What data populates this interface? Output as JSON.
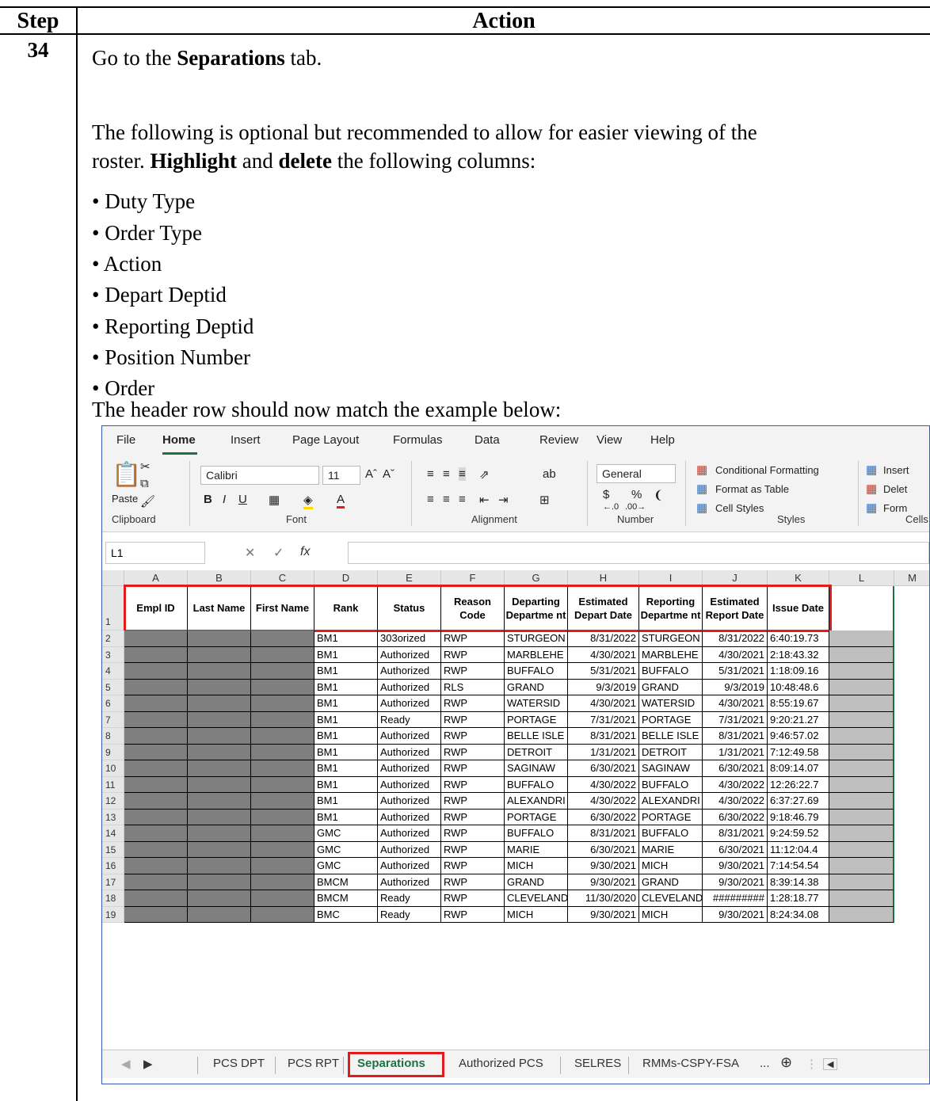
{
  "doc": {
    "header": {
      "step": "Step",
      "action": "Action"
    },
    "step_number": "34",
    "line1_pre": "Go to the ",
    "line1_bold": "Separations",
    "line1_post": " tab.",
    "para_line1": "The following is optional but recommended to allow for easier viewing of the",
    "para_line2_pre": "roster.  ",
    "para_line2_bold1": "Highlight",
    "para_line2_mid": " and ",
    "para_line2_bold2": "delete",
    "para_line2_post": " the following columns:",
    "bullets": [
      "Duty Type",
      "Order Type",
      "Action",
      "Depart Deptid",
      "Reporting Deptid",
      "Position Number",
      "Order"
    ],
    "closing": "The header row should now match the example below:"
  },
  "excel": {
    "menu": [
      "File",
      "Home",
      "Insert",
      "Page Layout",
      "Formulas",
      "Data",
      "Review",
      "View",
      "Help"
    ],
    "ribbon": {
      "paste": "Paste",
      "font_name": "Calibri",
      "font_size": "11",
      "number_format": "General",
      "conditional_formatting": "Conditional Formatting",
      "format_as_table": "Format as Table",
      "cell_styles": "Cell Styles",
      "insert": "Insert",
      "delete": "Delet",
      "format": "Form",
      "groups": [
        "Clipboard",
        "Font",
        "Alignment",
        "Number",
        "Styles",
        "Cells"
      ]
    },
    "name_box": "L1",
    "fx": "fx",
    "columns": [
      "A",
      "B",
      "C",
      "D",
      "E",
      "F",
      "G",
      "H",
      "I",
      "J",
      "K",
      "L",
      "M"
    ],
    "headers": [
      "Empl ID",
      "Last Name",
      "First Name",
      "Rank",
      "Status",
      "Reason Code",
      "Departing Departme nt",
      "Estimated Depart Date",
      "Reporting Departme nt",
      "Estimated Report Date",
      "Issue Date"
    ],
    "rows": [
      {
        "n": "2",
        "rank": "BM1",
        "status": "303orized",
        "reason": "RWP",
        "dep": "STURGEON",
        "depdate": "8/31/2022",
        "rep": "STURGEON",
        "repdate": "8/31/2022",
        "issue": "6:40:19.73"
      },
      {
        "n": "3",
        "rank": "BM1",
        "status": "Authorized",
        "reason": "RWP",
        "dep": "MARBLEHE",
        "depdate": "4/30/2021",
        "rep": "MARBLEHE",
        "repdate": "4/30/2021",
        "issue": "2:18:43.32"
      },
      {
        "n": "4",
        "rank": "BM1",
        "status": "Authorized",
        "reason": "RWP",
        "dep": "BUFFALO",
        "depdate": "5/31/2021",
        "rep": "BUFFALO",
        "repdate": "5/31/2021",
        "issue": "1:18:09.16"
      },
      {
        "n": "5",
        "rank": "BM1",
        "status": "Authorized",
        "reason": "RLS",
        "dep": "GRAND",
        "depdate": "9/3/2019",
        "rep": "GRAND",
        "repdate": "9/3/2019",
        "issue": "10:48:48.6"
      },
      {
        "n": "6",
        "rank": "BM1",
        "status": "Authorized",
        "reason": "RWP",
        "dep": "WATERSID",
        "depdate": "4/30/2021",
        "rep": "WATERSID",
        "repdate": "4/30/2021",
        "issue": "8:55:19.67"
      },
      {
        "n": "7",
        "rank": "BM1",
        "status": "Ready",
        "reason": "RWP",
        "dep": "PORTAGE",
        "depdate": "7/31/2021",
        "rep": "PORTAGE",
        "repdate": "7/31/2021",
        "issue": "9:20:21.27"
      },
      {
        "n": "8",
        "rank": "BM1",
        "status": "Authorized",
        "reason": "RWP",
        "dep": "BELLE ISLE",
        "depdate": "8/31/2021",
        "rep": "BELLE ISLE",
        "repdate": "8/31/2021",
        "issue": "9:46:57.02"
      },
      {
        "n": "9",
        "rank": "BM1",
        "status": "Authorized",
        "reason": "RWP",
        "dep": "DETROIT",
        "depdate": "1/31/2021",
        "rep": "DETROIT",
        "repdate": "1/31/2021",
        "issue": "7:12:49.58"
      },
      {
        "n": "10",
        "rank": "BM1",
        "status": "Authorized",
        "reason": "RWP",
        "dep": "SAGINAW",
        "depdate": "6/30/2021",
        "rep": "SAGINAW",
        "repdate": "6/30/2021",
        "issue": "8:09:14.07"
      },
      {
        "n": "11",
        "rank": "BM1",
        "status": "Authorized",
        "reason": "RWP",
        "dep": "BUFFALO",
        "depdate": "4/30/2022",
        "rep": "BUFFALO",
        "repdate": "4/30/2022",
        "issue": "12:26:22.7"
      },
      {
        "n": "12",
        "rank": "BM1",
        "status": "Authorized",
        "reason": "RWP",
        "dep": "ALEXANDRI",
        "depdate": "4/30/2022",
        "rep": "ALEXANDRI",
        "repdate": "4/30/2022",
        "issue": "6:37:27.69"
      },
      {
        "n": "13",
        "rank": "BM1",
        "status": "Authorized",
        "reason": "RWP",
        "dep": "PORTAGE",
        "depdate": "6/30/2022",
        "rep": "PORTAGE",
        "repdate": "6/30/2022",
        "issue": "9:18:46.79"
      },
      {
        "n": "14",
        "rank": "GMC",
        "status": "Authorized",
        "reason": "RWP",
        "dep": "BUFFALO",
        "depdate": "8/31/2021",
        "rep": "BUFFALO",
        "repdate": "8/31/2021",
        "issue": "9:24:59.52"
      },
      {
        "n": "15",
        "rank": "GMC",
        "status": "Authorized",
        "reason": "RWP",
        "dep": "MARIE",
        "depdate": "6/30/2021",
        "rep": "MARIE",
        "repdate": "6/30/2021",
        "issue": "11:12:04.4"
      },
      {
        "n": "16",
        "rank": "GMC",
        "status": "Authorized",
        "reason": "RWP",
        "dep": "MICH",
        "depdate": "9/30/2021",
        "rep": "MICH",
        "repdate": "9/30/2021",
        "issue": "7:14:54.54"
      },
      {
        "n": "17",
        "rank": "BMCM",
        "status": "Authorized",
        "reason": "RWP",
        "dep": "GRAND",
        "depdate": "9/30/2021",
        "rep": "GRAND",
        "repdate": "9/30/2021",
        "issue": "8:39:14.38"
      },
      {
        "n": "18",
        "rank": "BMCM",
        "status": "Ready",
        "reason": "RWP",
        "dep": "CLEVELAND",
        "depdate": "11/30/2020",
        "rep": "CLEVELAND",
        "repdate": "#########",
        "issue": "1:28:18.77"
      },
      {
        "n": "19",
        "rank": "BMC",
        "status": "Ready",
        "reason": "RWP",
        "dep": "MICH",
        "depdate": "9/30/2021",
        "rep": "MICH",
        "repdate": "9/30/2021",
        "issue": "8:24:34.08"
      }
    ],
    "sheet_tabs": [
      "PCS DPT",
      "PCS RPT",
      "Separations",
      "Authorized PCS",
      "SELRES",
      "RMMs-CSPY-FSA"
    ],
    "active_tab": "Separations",
    "more": "...",
    "accent": "#1e7145",
    "highlight": "#e21c1c"
  }
}
